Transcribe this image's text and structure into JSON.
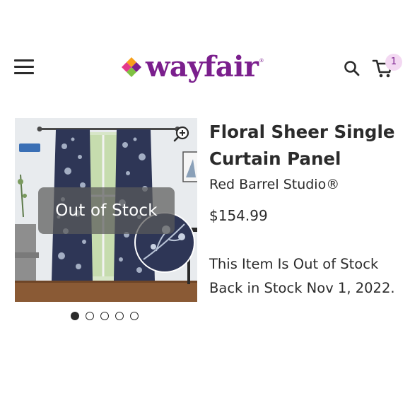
{
  "header": {
    "logo_text": "wayfair",
    "logo_tm": "®",
    "cart_count": "1"
  },
  "product": {
    "image_overlay": "Out of Stock",
    "title": "Floral Sheer Single Curtain Panel",
    "brand": "Red Barrel Studio®",
    "price": "$154.99",
    "stock_status": "This Item Is Out of Stock",
    "back_in_stock": "Back in Stock Nov 1, 2022.",
    "carousel": {
      "total": 5,
      "active": 1
    }
  },
  "colors": {
    "brand_purple": "#7b1f8d",
    "text": "#2b2b2b",
    "badge_bg": "#f3d8f2",
    "curtain_navy": "#2e3656"
  }
}
